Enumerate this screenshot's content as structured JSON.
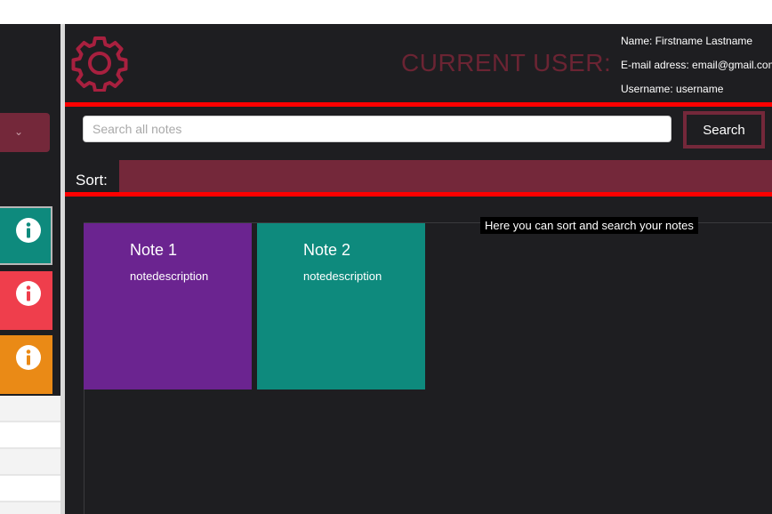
{
  "header": {
    "current_user_label": "CURRENT USER:",
    "user_info": {
      "name": "Name: Firstname Lastname",
      "email": "E-mail adress: email@gmail.com",
      "username": "Username: username"
    }
  },
  "toolbar": {
    "search_placeholder": "Search all notes",
    "search_value": "",
    "search_button_label": "Search",
    "sort_label": "Sort:"
  },
  "tooltip": "Here you can sort and search your notes",
  "notes": [
    {
      "title": "Note 1",
      "description": "notedescription",
      "color": "#6b2490"
    },
    {
      "title": "Note 2",
      "description": "notedescription",
      "color": "#0e8a7d"
    }
  ],
  "sidebar": {
    "cards": [
      {
        "color": "#0e8a7d",
        "icon": "info-icon"
      },
      {
        "color": "#ef3e4c",
        "icon": "info-icon"
      },
      {
        "color": "#ea8a16",
        "icon": "info-icon"
      }
    ],
    "dropdown_icon": "chevron-down-icon"
  },
  "colors": {
    "accent": "#74283a",
    "background": "#1e1e21",
    "highlight": "#ff0000"
  }
}
